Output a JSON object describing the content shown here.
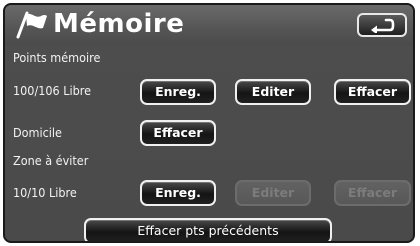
{
  "header": {
    "title": "Mémoire",
    "back_icon": "return-arrow-icon"
  },
  "memory_points": {
    "section_label": "Points mémoire",
    "status": "100/106 Libre",
    "save_label": "Enreg.",
    "edit_label": "Editer",
    "delete_label": "Effacer"
  },
  "home": {
    "label": "Domicile",
    "delete_label": "Effacer"
  },
  "avoid_zone": {
    "section_label": "Zone à éviter",
    "status": "10/10 Libre",
    "save_label": "Enreg.",
    "edit_label": "Editer",
    "delete_label": "Effacer",
    "edit_enabled": false,
    "delete_enabled": false
  },
  "footer": {
    "clear_previous_label": "Effacer pts précédents"
  },
  "colors": {
    "panel_bg": "#4d4d4d",
    "button_bg": "#1e1e1e",
    "button_border": "#f0f0f0",
    "disabled_text": "#7c7c7c"
  }
}
